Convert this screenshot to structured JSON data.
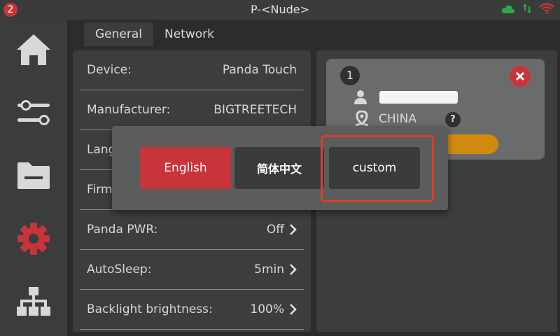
{
  "topbar": {
    "badge": "2",
    "title": "P-<Nude>",
    "icons": [
      "cloud-icon",
      "transfer-arrows-icon",
      "wifi-icon"
    ],
    "colors": {
      "cloud": "#2fa84a",
      "transfer": "#2fa84a",
      "wifi": "#c8343a"
    }
  },
  "sidebar": {
    "items": [
      {
        "name": "home",
        "icon": "home-icon"
      },
      {
        "name": "controls",
        "icon": "sliders-icon"
      },
      {
        "name": "files",
        "icon": "folder-icon"
      },
      {
        "name": "settings",
        "icon": "gear-icon",
        "active": true,
        "active_color": "#c8343a"
      },
      {
        "name": "network",
        "icon": "network-tree-icon"
      }
    ]
  },
  "tabs": [
    {
      "label": "General",
      "active": true
    },
    {
      "label": "Network",
      "active": false
    }
  ],
  "settings": [
    {
      "label": "Device:",
      "value": "Panda Touch",
      "chevron": false
    },
    {
      "label": "Manufacturer:",
      "value": "BIGTREETECH",
      "chevron": false
    },
    {
      "label": "Lang",
      "value": "",
      "chevron": false
    },
    {
      "label": "Firm",
      "value": "",
      "chevron": false
    },
    {
      "label": "Panda PWR:",
      "value": "Off",
      "chevron": true
    },
    {
      "label": "AutoSleep:",
      "value": "5min",
      "chevron": true
    },
    {
      "label": "Backlight brightness:",
      "value": "100%",
      "chevron": true
    }
  ],
  "printer_card": {
    "index": "1",
    "country": "CHINA",
    "help": "?"
  },
  "language_popup": {
    "options": [
      "English",
      "简体中文",
      "custom"
    ],
    "selected": "English",
    "accent": "#c8343a",
    "highlight_color": "#e03a2c"
  }
}
